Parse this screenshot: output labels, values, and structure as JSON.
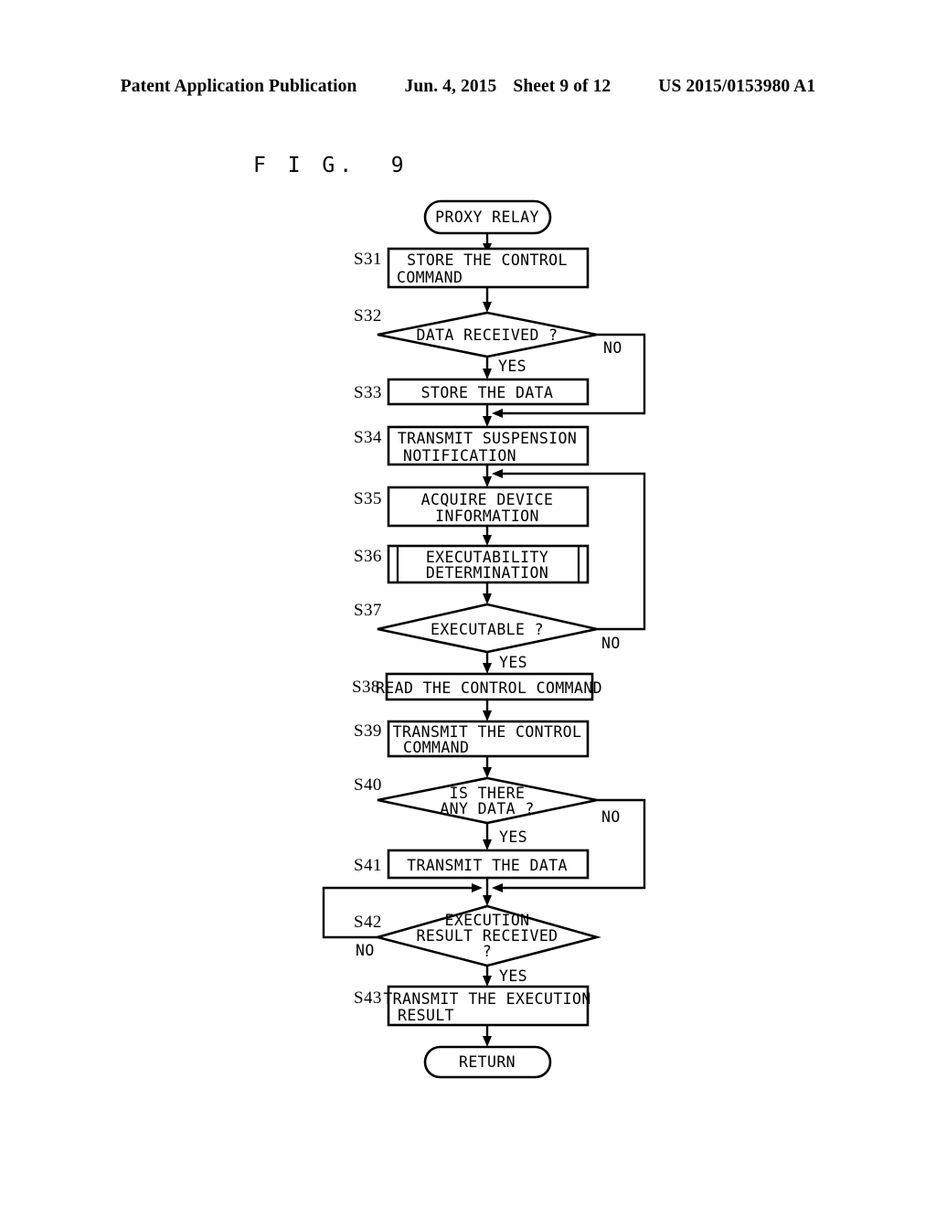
{
  "header": {
    "publication": "Patent Application Publication",
    "date": "Jun. 4, 2015",
    "sheet": "Sheet 9 of 12",
    "number": "US 2015/0153980 A1"
  },
  "figure": {
    "label": "F I G.  9"
  },
  "flowchart": {
    "start_terminator": "PROXY RELAY",
    "end_terminator": "RETURN",
    "yes_label": "YES",
    "no_label": "NO",
    "steps": [
      {
        "id": "S31",
        "type": "process",
        "text": "STORE THE CONTROL COMMAND",
        "lines": [
          "STORE THE CONTROL",
          "COMMAND"
        ]
      },
      {
        "id": "S32",
        "type": "decision",
        "text": "DATA RECEIVED ?",
        "lines": [
          "DATA RECEIVED ?"
        ]
      },
      {
        "id": "S33",
        "type": "process",
        "text": "STORE THE DATA",
        "lines": [
          "STORE THE DATA"
        ]
      },
      {
        "id": "S34",
        "type": "process",
        "text": "TRANSMIT SUSPENSION NOTIFICATION",
        "lines": [
          "TRANSMIT SUSPENSION",
          "NOTIFICATION"
        ]
      },
      {
        "id": "S35",
        "type": "process",
        "text": "ACQUIRE DEVICE INFORMATION",
        "lines": [
          "ACQUIRE DEVICE",
          "INFORMATION"
        ]
      },
      {
        "id": "S36",
        "type": "predefined",
        "text": "EXECUTABILITY DETERMINATION",
        "lines": [
          "EXECUTABILITY",
          "DETERMINATION"
        ]
      },
      {
        "id": "S37",
        "type": "decision",
        "text": "EXECUTABLE ?",
        "lines": [
          "EXECUTABLE ?"
        ]
      },
      {
        "id": "S38",
        "type": "process",
        "text": "READ THE CONTROL COMMAND",
        "lines": [
          "READ THE CONTROL COMMAND"
        ]
      },
      {
        "id": "S39",
        "type": "process",
        "text": "TRANSMIT THE CONTROL COMMAND",
        "lines": [
          "TRANSMIT THE CONTROL",
          "COMMAND"
        ]
      },
      {
        "id": "S40",
        "type": "decision",
        "text": "IS THERE ANY DATA ?",
        "lines": [
          "IS THERE",
          "ANY DATA ?"
        ]
      },
      {
        "id": "S41",
        "type": "process",
        "text": "TRANSMIT THE DATA",
        "lines": [
          "TRANSMIT THE DATA"
        ]
      },
      {
        "id": "S42",
        "type": "decision",
        "text": "EXECUTION RESULT RECEIVED ?",
        "lines": [
          "EXECUTION",
          "RESULT RECEIVED",
          "?"
        ]
      },
      {
        "id": "S43",
        "type": "process",
        "text": "TRANSMIT THE EXECUTION RESULT",
        "lines": [
          "TRANSMIT THE EXECUTION",
          "RESULT"
        ]
      }
    ],
    "branches": [
      {
        "from": "S32",
        "label": "YES",
        "to": "S33"
      },
      {
        "from": "S32",
        "label": "NO",
        "to": "S34"
      },
      {
        "from": "S37",
        "label": "YES",
        "to": "S38"
      },
      {
        "from": "S37",
        "label": "NO",
        "to": "S35"
      },
      {
        "from": "S40",
        "label": "YES",
        "to": "S41"
      },
      {
        "from": "S40",
        "label": "NO",
        "to": "S42"
      },
      {
        "from": "S42",
        "label": "YES",
        "to": "S43"
      },
      {
        "from": "S42",
        "label": "NO",
        "to": "S42"
      }
    ]
  },
  "colors": {
    "ink": "#000000",
    "paper": "#ffffff"
  }
}
